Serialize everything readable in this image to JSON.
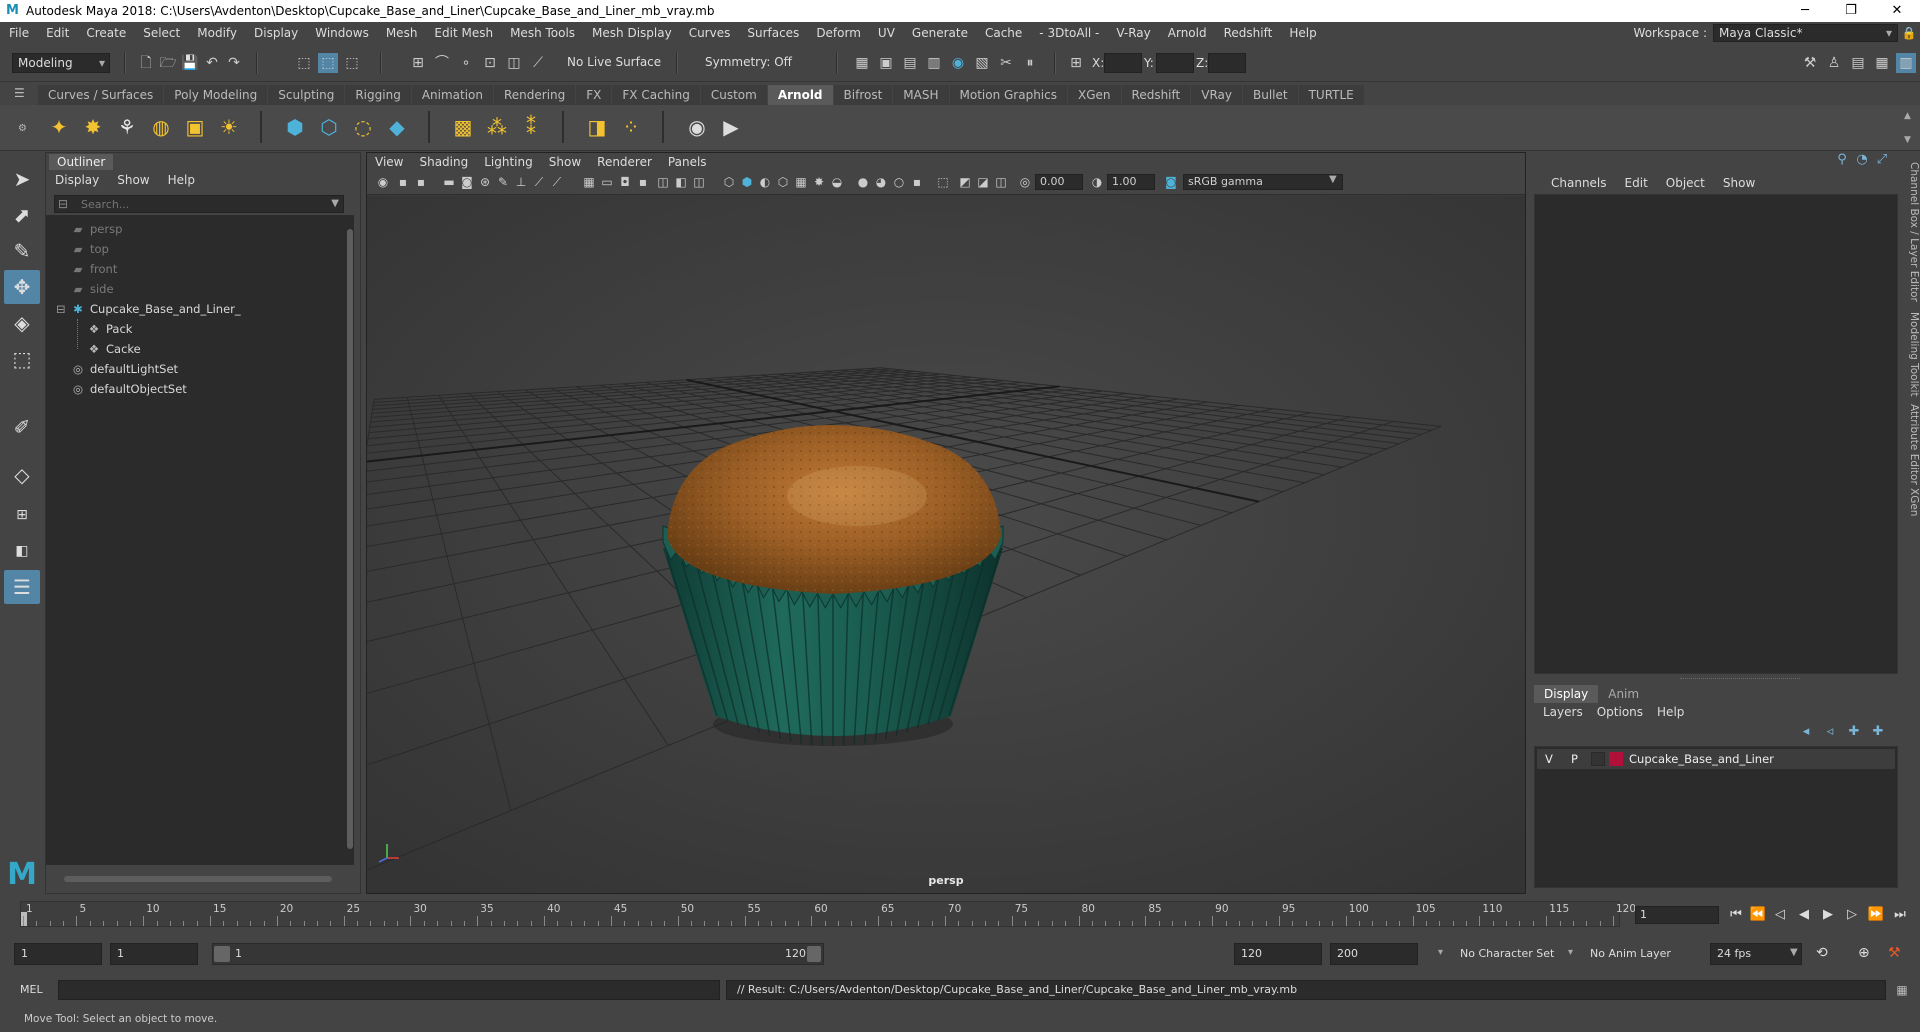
{
  "window": {
    "title": "Autodesk Maya 2018: C:\\Users\\Avdenton\\Desktop\\Cupcake_Base_and_Liner\\Cupcake_Base_and_Liner_mb_vray.mb",
    "minimize": "─",
    "maximize": "❐",
    "close": "✕"
  },
  "menubar": {
    "items": [
      "File",
      "Edit",
      "Create",
      "Select",
      "Modify",
      "Display",
      "Windows",
      "Mesh",
      "Edit Mesh",
      "Mesh Tools",
      "Mesh Display",
      "Curves",
      "Surfaces",
      "Deform",
      "UV",
      "Generate",
      "Cache",
      "- 3DtoAll -",
      "V-Ray",
      "Arnold",
      "Redshift",
      "Help"
    ],
    "workspace_label": "Workspace :",
    "workspace_value": "Maya Classic*"
  },
  "statusline": {
    "mode": "Modeling",
    "live_surface": "No Live Surface",
    "symmetry": "Symmetry: Off",
    "x_label": "X:",
    "y_label": "Y:",
    "z_label": "Z:"
  },
  "shelf": {
    "tabs": [
      "Curves / Surfaces",
      "Poly Modeling",
      "Sculpting",
      "Rigging",
      "Animation",
      "Rendering",
      "FX",
      "FX Caching",
      "Custom",
      "Arnold",
      "Bifrost",
      "MASH",
      "Motion Graphics",
      "XGen",
      "Redshift",
      "VRay",
      "Bullet",
      "TURTLE"
    ],
    "active_tab": "Arnold"
  },
  "outliner": {
    "title": "Outliner",
    "menu": [
      "Display",
      "Show",
      "Help"
    ],
    "search_placeholder": "Search...",
    "items": [
      {
        "label": "persp",
        "icon": "camera-icon",
        "dim": true,
        "indent": 0
      },
      {
        "label": "top",
        "icon": "camera-icon",
        "dim": true,
        "indent": 0
      },
      {
        "label": "front",
        "icon": "camera-icon",
        "dim": true,
        "indent": 0
      },
      {
        "label": "side",
        "icon": "camera-icon",
        "dim": true,
        "indent": 0
      },
      {
        "label": "Cupcake_Base_and_Liner_",
        "icon": "group-icon",
        "dim": false,
        "indent": 0,
        "expanded": true
      },
      {
        "label": "Pack",
        "icon": "mesh-icon",
        "dim": false,
        "indent": 1
      },
      {
        "label": "Cacke",
        "icon": "mesh-icon",
        "dim": false,
        "indent": 1
      },
      {
        "label": "defaultLightSet",
        "icon": "set-icon",
        "dim": false,
        "indent": 0
      },
      {
        "label": "defaultObjectSet",
        "icon": "set-icon",
        "dim": false,
        "indent": 0
      }
    ]
  },
  "viewport": {
    "menu": [
      "View",
      "Shading",
      "Lighting",
      "Show",
      "Renderer",
      "Panels"
    ],
    "exposure": "0.00",
    "gamma": "1.00",
    "color_space": "sRGB gamma",
    "camera": "persp"
  },
  "channelbox": {
    "menu": [
      "Channels",
      "Edit",
      "Object",
      "Show"
    ],
    "side_tabs": [
      "Channel Box / Layer Editor",
      "Modeling Toolkit",
      "Attribute Editor",
      "XGen"
    ],
    "layer_tabs": [
      "Display",
      "Anim"
    ],
    "layer_menu": [
      "Layers",
      "Options",
      "Help"
    ],
    "layer": {
      "v": "V",
      "p": "P",
      "name": "Cupcake_Base_and_Liner",
      "color": "#b0103a"
    }
  },
  "timeslider": {
    "ticks": [
      "1",
      "5",
      "10",
      "15",
      "20",
      "25",
      "30",
      "35",
      "40",
      "45",
      "50",
      "55",
      "60",
      "65",
      "70",
      "75",
      "80",
      "85",
      "90",
      "95",
      "100",
      "105",
      "110",
      "115",
      "120"
    ],
    "current_frame": "1"
  },
  "rangeslider": {
    "start": "1",
    "playback_start": "1",
    "range_start_label": "1",
    "range_end_label": "120",
    "playback_end": "120",
    "end": "200",
    "character_set": "No Character Set",
    "anim_layer": "No Anim Layer",
    "fps": "24 fps"
  },
  "cmdline": {
    "lang": "MEL",
    "result": "// Result: C:/Users/Avdenton/Desktop/Cupcake_Base_and_Liner/Cupcake_Base_and_Liner_mb_vray.mb"
  },
  "helpline": {
    "text": "Move Tool: Select an object to move."
  }
}
